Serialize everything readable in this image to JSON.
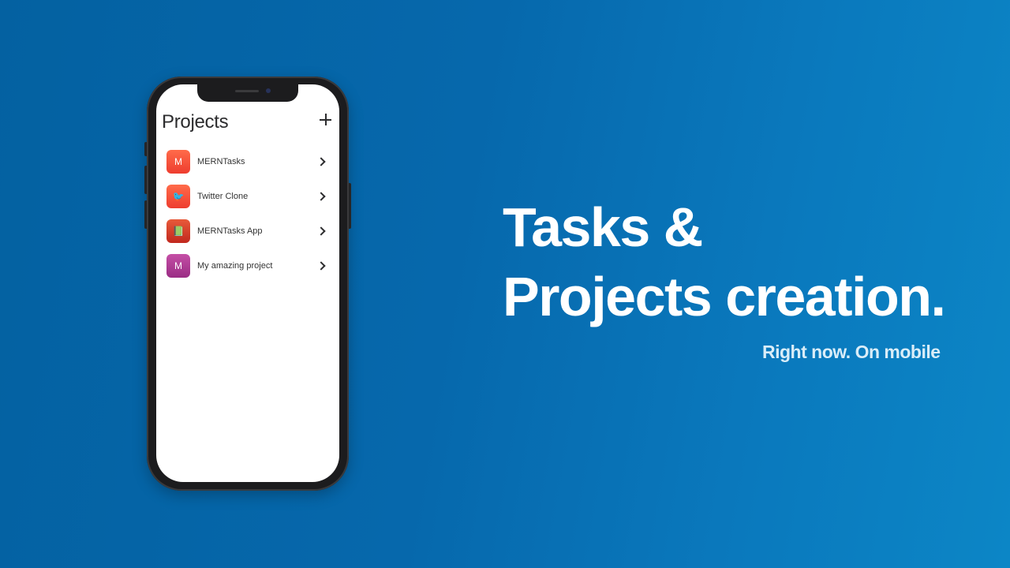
{
  "phone": {
    "app_title": "Projects",
    "add_icon": "plus-icon",
    "projects": [
      {
        "name": "MERNTasks",
        "icon_letter": "M",
        "icon_kind": "letter"
      },
      {
        "name": "Twitter Clone",
        "icon_letter": "🐦",
        "icon_kind": "emoji"
      },
      {
        "name": "MERNTasks App",
        "icon_letter": "📗",
        "icon_kind": "emoji"
      },
      {
        "name": "My amazing project",
        "icon_letter": "M",
        "icon_kind": "letter"
      }
    ]
  },
  "hero": {
    "headline_line1": "Tasks &",
    "headline_line2": "Projects creation.",
    "tagline": "Right now. On mobile"
  },
  "colors": {
    "background_start": "#0461a1",
    "background_end": "#0c86c6",
    "text_primary": "#ffffff",
    "text_secondary": "#d9edf8"
  }
}
